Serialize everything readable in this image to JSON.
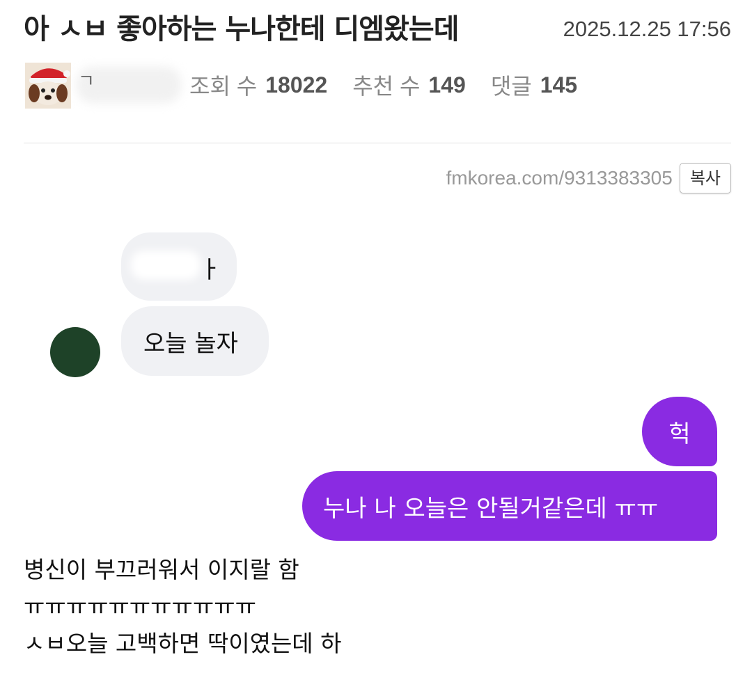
{
  "post": {
    "title": "아 ㅅㅂ 좋아하는 누나한테 디엠왔는데",
    "datetime": "2025.12.25 17:56",
    "author_visible_char": "ㄱ",
    "stats": {
      "views_label": "조회 수",
      "views_value": "18022",
      "likes_label": "추천 수",
      "likes_value": "149",
      "comments_label": "댓글",
      "comments_value": "145"
    },
    "url": "fmkorea.com/9313383305",
    "copy_label": "복사"
  },
  "chat": {
    "received": [
      {
        "text": "ㅏ",
        "redacted": true
      },
      {
        "text": "오늘 놀자"
      }
    ],
    "sent": [
      {
        "text": "헉"
      },
      {
        "text": "누나 나 오늘은 안될거같은데 ㅠㅠ"
      }
    ],
    "colors": {
      "sent_bubble": "#8a2be2",
      "received_bubble": "#f0f1f4",
      "contact_avatar": "#1e4228"
    },
    "icons": {
      "contact_avatar": "contact-avatar-circle",
      "author_avatar": "santa-hat-puppy-avatar"
    }
  },
  "body": {
    "lines": [
      "병신이 부끄러워서 이지랄 함",
      "ㅠㅠㅠㅠㅠㅠㅠㅠㅠㅠㅠ",
      "ㅅㅂ오늘 고백하면 딱이였는데 하"
    ]
  }
}
